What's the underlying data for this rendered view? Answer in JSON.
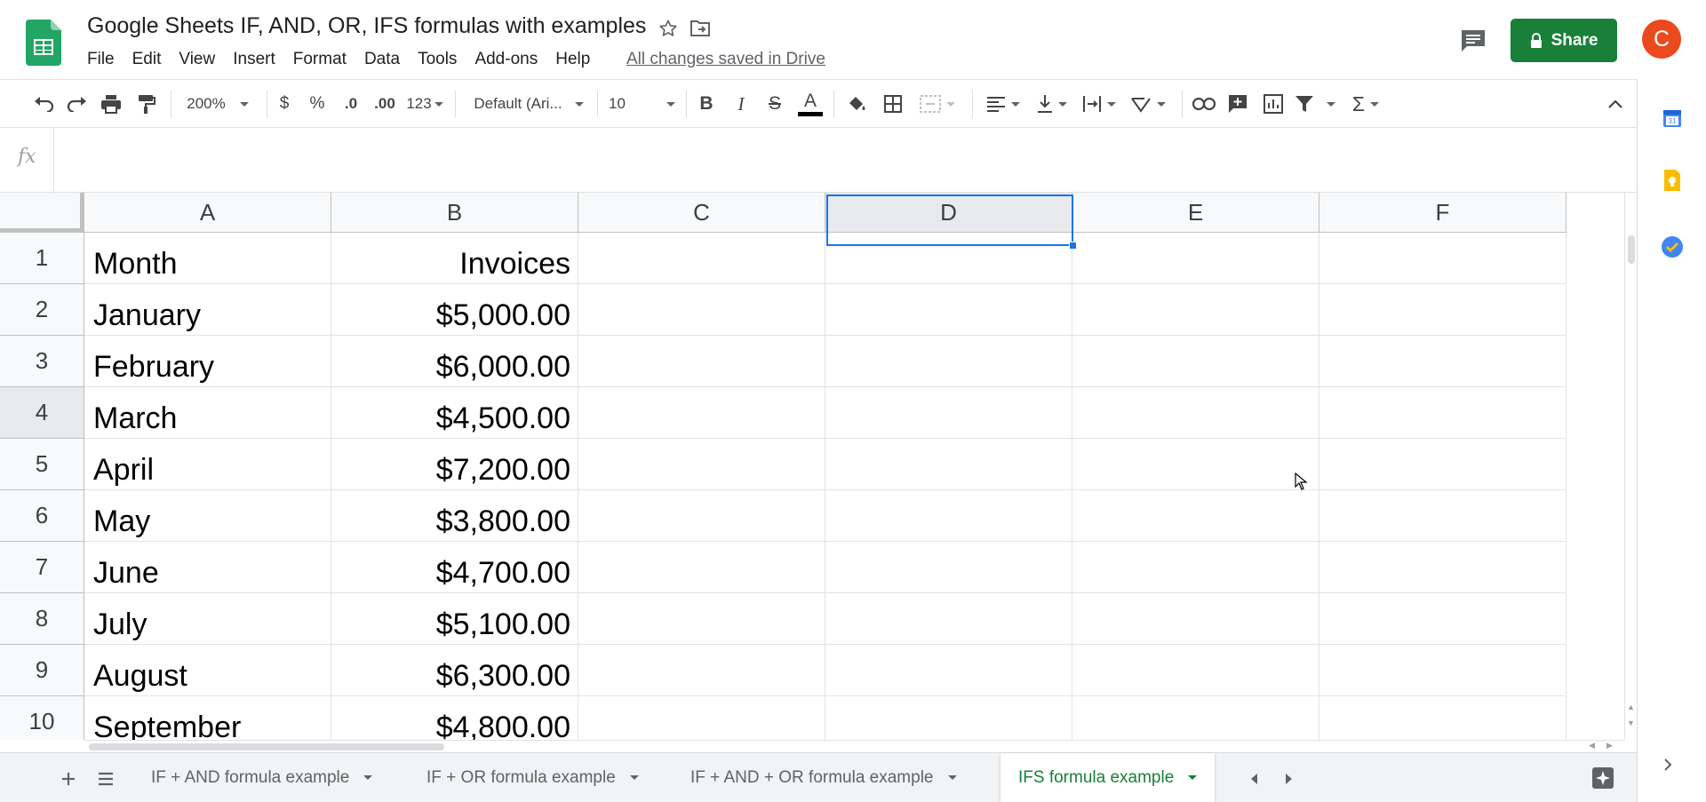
{
  "document": {
    "title": "Google Sheets IF, AND, OR, IFS formulas with examples",
    "saved_status": "All changes saved in Drive"
  },
  "menu": [
    "File",
    "Edit",
    "View",
    "Insert",
    "Format",
    "Data",
    "Tools",
    "Add-ons",
    "Help"
  ],
  "share": {
    "label": "Share"
  },
  "user": {
    "avatar_letter": "C",
    "avatar_color": "#ea4a1c"
  },
  "toolbar": {
    "zoom": "200%",
    "currency": "$",
    "percent": "%",
    "decrease_decimal": ".0",
    "increase_decimal": ".00",
    "more_formats": "123",
    "font": "Default (Ari...",
    "font_size": "10",
    "bold": "B",
    "italic": "I",
    "strikethrough": "S",
    "text_color": "A",
    "sum": "Σ"
  },
  "formula_bar": {
    "fx_label": "fx",
    "value": ""
  },
  "grid": {
    "columns": [
      "A",
      "B",
      "C",
      "D",
      "E",
      "F"
    ],
    "rows": [
      "1",
      "2",
      "3",
      "4",
      "5",
      "6",
      "7",
      "8",
      "9",
      "10"
    ],
    "active_column": "D",
    "active_row": "4",
    "data": [
      [
        "Month",
        "Invoices"
      ],
      [
        "January",
        "$5,000.00"
      ],
      [
        "February",
        "$6,000.00"
      ],
      [
        "March",
        "$4,500.00"
      ],
      [
        "April",
        "$7,200.00"
      ],
      [
        "May",
        "$3,800.00"
      ],
      [
        "June",
        "$4,700.00"
      ],
      [
        "July",
        "$5,100.00"
      ],
      [
        "August",
        "$6,300.00"
      ],
      [
        "September",
        "$4,800.00"
      ]
    ]
  },
  "sheets": [
    {
      "name": "IF + AND formula example",
      "active": false
    },
    {
      "name": "IF + OR formula example",
      "active": false
    },
    {
      "name": "IF + AND + OR formula example",
      "active": false
    },
    {
      "name": "IFS formula example",
      "active": true
    }
  ],
  "colors": {
    "accent_green": "#188038",
    "selection_blue": "#1a73e8"
  }
}
